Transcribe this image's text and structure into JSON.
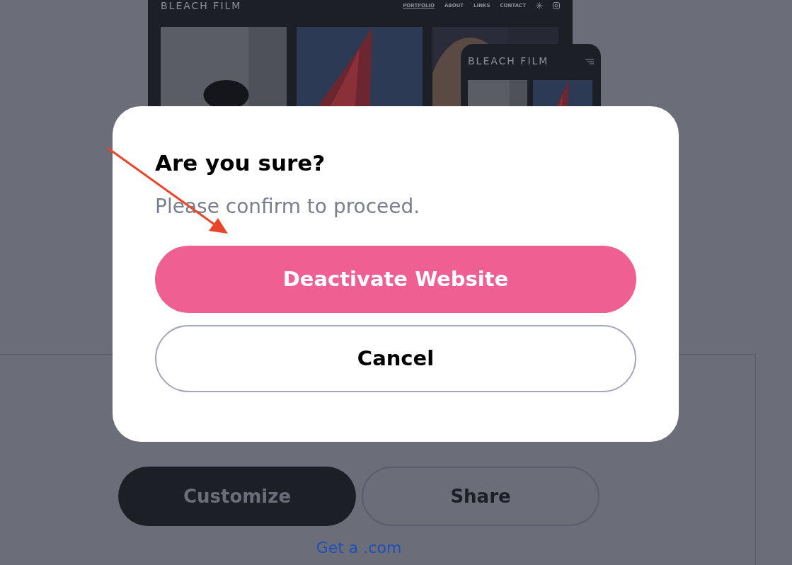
{
  "preview": {
    "desktop": {
      "brand": "BLEACH FILM",
      "nav": [
        {
          "label": "PORTFOLIO",
          "selected": true
        },
        {
          "label": "ABOUT",
          "selected": false
        },
        {
          "label": "LINKS",
          "selected": false
        },
        {
          "label": "CONTACT",
          "selected": false
        }
      ]
    },
    "mobile": {
      "brand": "BLEACH FILM"
    }
  },
  "dialog": {
    "title": "Are you sure?",
    "message": "Please confirm to proceed.",
    "buttons": [
      {
        "label": "Deactivate Website",
        "kind": "primary"
      },
      {
        "label": "Cancel",
        "kind": "secondary"
      }
    ]
  },
  "actions": [
    {
      "label": "Customize",
      "kind": "primary"
    },
    {
      "label": "Share",
      "kind": "secondary"
    }
  ],
  "link": "Get a .com"
}
